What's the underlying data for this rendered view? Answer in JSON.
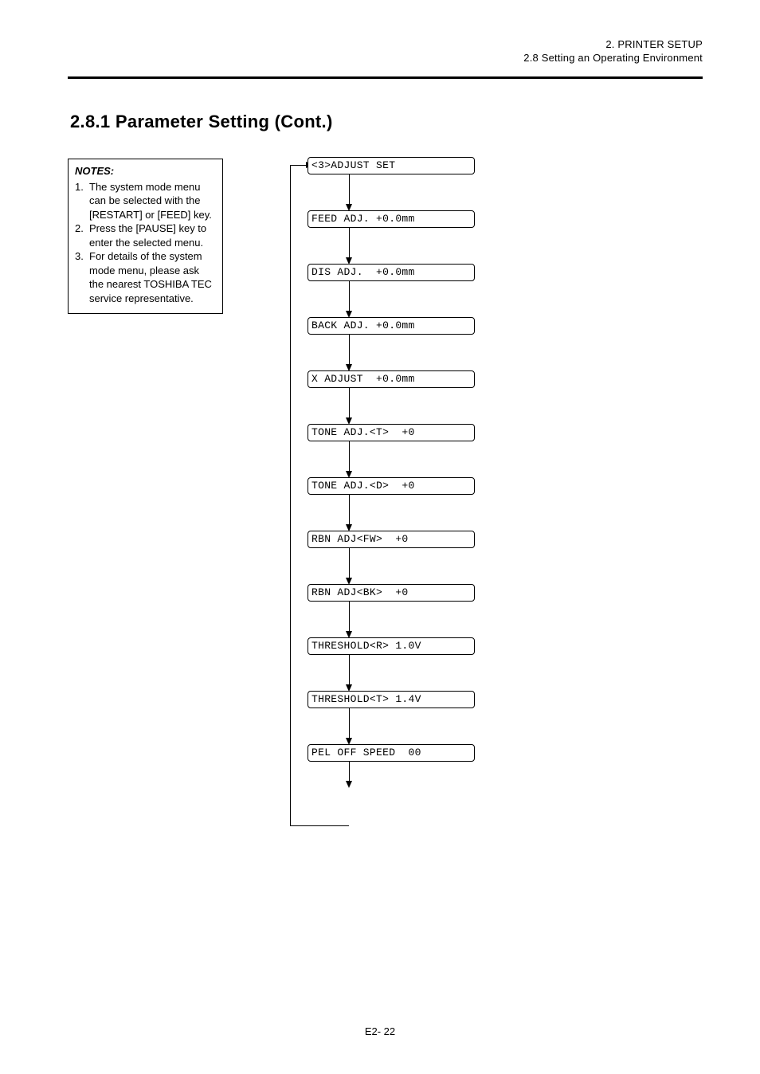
{
  "header": {
    "line1": "2. PRINTER SETUP",
    "line2": "2.8 Setting an Operating Environment"
  },
  "section_title": "2.8.1 Parameter Setting (Cont.)",
  "note": {
    "title": "NOTES:",
    "items": [
      {
        "n": "1.",
        "text": "The system mode menu can be selected with the [RESTART] or [FEED] key."
      },
      {
        "n": "2.",
        "text": "Press the [PAUSE] key to enter the selected menu."
      },
      {
        "n": "3.",
        "text": "For details of the system mode menu, please ask the nearest TOSHIBA TEC service representative."
      }
    ]
  },
  "flow": {
    "boxes": [
      "<3>ADJUST SET",
      "FEED ADJ. +0.0mm",
      "DIS ADJ.  +0.0mm",
      "BACK ADJ. +0.0mm",
      "X ADJUST  +0.0mm",
      "TONE ADJ.<T>  +0",
      "TONE ADJ.<D>  +0",
      "RBN ADJ<FW>  +0",
      "RBN ADJ<BK>  +0",
      "THRESHOLD<R> 1.0V",
      "THRESHOLD<T> 1.4V",
      "PEL OFF SPEED  00"
    ]
  },
  "footer": "E2- 22"
}
